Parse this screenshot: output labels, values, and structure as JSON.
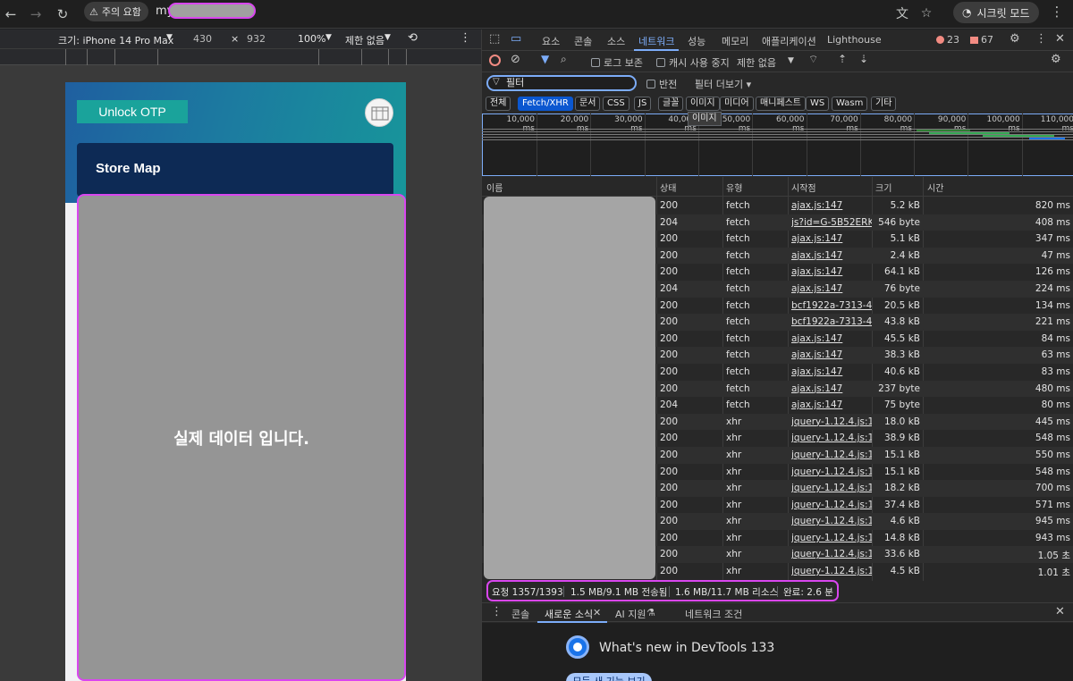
{
  "browser": {
    "warning_label": "주의 요함",
    "url_prefix": "my",
    "incognito_label": "시크릿 모드"
  },
  "device_toolbar": {
    "device": "크기: iPhone 14 Pro Max",
    "width": "430",
    "times": "×",
    "height": "932",
    "zoom": "100%",
    "throttle": "제한 없음"
  },
  "page": {
    "otp_button": "Unlock OTP",
    "store_map": "Store Map",
    "masked_message": "실제 데이터 입니다."
  },
  "devtools": {
    "tabs": [
      "요소",
      "콘솔",
      "소스",
      "네트워크",
      "성능",
      "메모리",
      "애플리케이션",
      "Lighthouse"
    ],
    "active_tab": "네트워크",
    "error_count": "23",
    "issue_count": "67",
    "toolbar": {
      "preserve_log": "로그 보존",
      "disable_cache": "캐시 사용 중지",
      "throttle": "제한 없음"
    },
    "filter": {
      "placeholder": "필터",
      "invert": "반전",
      "more_filters": "필터 더보기"
    },
    "type_filters": [
      "전체",
      "Fetch/XHR",
      "문서",
      "CSS",
      "JS",
      "글꼴",
      "이미지",
      "미디어",
      "매니페스트",
      "WS",
      "Wasm",
      "기타"
    ],
    "active_type": "Fetch/XHR",
    "tooltip": "이미지",
    "timeline_ticks": [
      "10,000 ms",
      "20,000 ms",
      "30,000 ms",
      "40,000 ms",
      "50,000 ms",
      "60,000 ms",
      "70,000 ms",
      "80,000 ms",
      "90,000 ms",
      "100,000 ms",
      "110,000 ms"
    ],
    "columns": {
      "name": "이름",
      "status": "상태",
      "type": "유형",
      "initiator": "시작점",
      "size": "크기",
      "time": "시간"
    },
    "requests": [
      {
        "status": "200",
        "type": "fetch",
        "initiator": "ajax.js:147",
        "size": "5.2 kB",
        "time": "820 ms"
      },
      {
        "status": "204",
        "type": "fetch",
        "initiator": "js?id=G-5B52ERK",
        "size": "546 byte",
        "time": "408 ms"
      },
      {
        "status": "200",
        "type": "fetch",
        "initiator": "ajax.js:147",
        "size": "5.1 kB",
        "time": "347 ms"
      },
      {
        "status": "200",
        "type": "fetch",
        "initiator": "ajax.js:147",
        "size": "2.4 kB",
        "time": "47 ms"
      },
      {
        "status": "200",
        "type": "fetch",
        "initiator": "ajax.js:147",
        "size": "64.1 kB",
        "time": "126 ms"
      },
      {
        "status": "204",
        "type": "fetch",
        "initiator": "ajax.js:147",
        "size": "76 byte",
        "time": "224 ms"
      },
      {
        "status": "200",
        "type": "fetch",
        "initiator": "bcf1922a-7313-45",
        "size": "20.5 kB",
        "time": "134 ms"
      },
      {
        "status": "200",
        "type": "fetch",
        "initiator": "bcf1922a-7313-45",
        "size": "43.8 kB",
        "time": "221 ms"
      },
      {
        "status": "200",
        "type": "fetch",
        "initiator": "ajax.js:147",
        "size": "45.5 kB",
        "time": "84 ms"
      },
      {
        "status": "200",
        "type": "fetch",
        "initiator": "ajax.js:147",
        "size": "38.3 kB",
        "time": "63 ms"
      },
      {
        "status": "200",
        "type": "fetch",
        "initiator": "ajax.js:147",
        "size": "40.6 kB",
        "time": "83 ms"
      },
      {
        "status": "200",
        "type": "fetch",
        "initiator": "ajax.js:147",
        "size": "237 byte",
        "time": "480 ms"
      },
      {
        "status": "204",
        "type": "fetch",
        "initiator": "ajax.js:147",
        "size": "75 byte",
        "time": "80 ms"
      },
      {
        "status": "200",
        "type": "xhr",
        "initiator": "jquery-1.12.4.js:10",
        "size": "18.0 kB",
        "time": "445 ms"
      },
      {
        "status": "200",
        "type": "xhr",
        "initiator": "jquery-1.12.4.js:10",
        "size": "38.9 kB",
        "time": "548 ms"
      },
      {
        "status": "200",
        "type": "xhr",
        "initiator": "jquery-1.12.4.js:10",
        "size": "15.1 kB",
        "time": "550 ms"
      },
      {
        "status": "200",
        "type": "xhr",
        "initiator": "jquery-1.12.4.js:10",
        "size": "15.1 kB",
        "time": "548 ms"
      },
      {
        "status": "200",
        "type": "xhr",
        "initiator": "jquery-1.12.4.js:10",
        "size": "18.2 kB",
        "time": "700 ms"
      },
      {
        "status": "200",
        "type": "xhr",
        "initiator": "jquery-1.12.4.js:10",
        "size": "37.4 kB",
        "time": "571 ms"
      },
      {
        "status": "200",
        "type": "xhr",
        "initiator": "jquery-1.12.4.js:10",
        "size": "4.6 kB",
        "time": "945 ms"
      },
      {
        "status": "200",
        "type": "xhr",
        "initiator": "jquery-1.12.4.js:10",
        "size": "14.8 kB",
        "time": "943 ms"
      },
      {
        "status": "200",
        "type": "xhr",
        "initiator": "jquery-1.12.4.js:10",
        "size": "33.6 kB",
        "time": "1.05 초"
      },
      {
        "status": "200",
        "type": "xhr",
        "initiator": "jquery-1.12.4.js:10",
        "size": "4.5 kB",
        "time": "1.01 초"
      }
    ],
    "summary": {
      "requests": "요청 1357/1393",
      "transferred": "1.5 MB/9.1 MB 전송됨",
      "resources": "1.6 MB/11.7 MB 리소스",
      "finish": "완료: 2.6 분"
    },
    "drawer": {
      "tabs": [
        "콘솔",
        "새로운 소식",
        "AI 지원",
        "네트워크 조건"
      ],
      "whats_new_title": "What's new in DevTools 133",
      "button": "모든 새 기능 보기"
    }
  }
}
